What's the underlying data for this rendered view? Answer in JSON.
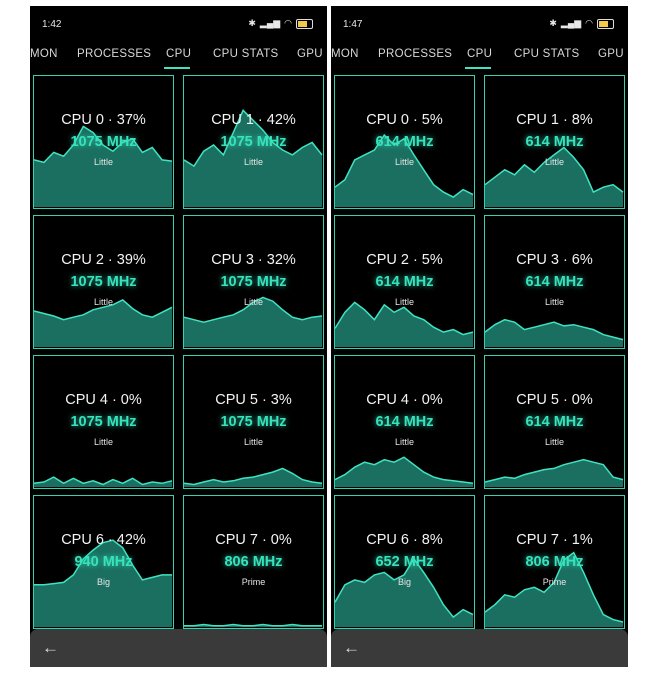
{
  "colors": {
    "accent": "#36e3bd",
    "graph_fill": "#1b6f60",
    "graph_line": "#3fe3c2",
    "border": "#37d1b1"
  },
  "screens": [
    {
      "time": "1:42",
      "tabs": [
        "MON",
        "PROCESSES",
        "CPU",
        "CPU STATS",
        "GPU"
      ],
      "active_tab": "CPU",
      "back_icon": "←",
      "cores": [
        {
          "label": "CPU 0 · 37%",
          "freq": "1075 MHz",
          "type": "Little",
          "graph": [
            0.38,
            0.36,
            0.44,
            0.41,
            0.5,
            0.65,
            0.6,
            0.5,
            0.45,
            0.52,
            0.55,
            0.44,
            0.48,
            0.38,
            0.37
          ]
        },
        {
          "label": "CPU 1 · 42%",
          "freq": "1075 MHz",
          "type": "Little",
          "graph": [
            0.38,
            0.33,
            0.45,
            0.5,
            0.42,
            0.6,
            0.78,
            0.7,
            0.62,
            0.52,
            0.46,
            0.42,
            0.48,
            0.52,
            0.42
          ]
        },
        {
          "label": "CPU 2 · 39%",
          "freq": "1075 MHz",
          "type": "Little",
          "graph": [
            0.29,
            0.27,
            0.25,
            0.22,
            0.24,
            0.26,
            0.3,
            0.32,
            0.34,
            0.38,
            0.31,
            0.26,
            0.24,
            0.28,
            0.32
          ]
        },
        {
          "label": "CPU 3 · 32%",
          "freq": "1075 MHz",
          "type": "Little",
          "graph": [
            0.24,
            0.22,
            0.2,
            0.22,
            0.24,
            0.26,
            0.3,
            0.36,
            0.4,
            0.37,
            0.3,
            0.24,
            0.22,
            0.24,
            0.25
          ]
        },
        {
          "label": "CPU 4 · 0%",
          "freq": "1075 MHz",
          "type": "Little",
          "graph": [
            0.03,
            0.04,
            0.08,
            0.03,
            0.07,
            0.03,
            0.05,
            0.02,
            0.06,
            0.03,
            0.07,
            0.02,
            0.04,
            0.03,
            0.05
          ]
        },
        {
          "label": "CPU 5 · 3%",
          "freq": "1075 MHz",
          "type": "Little",
          "graph": [
            0.03,
            0.02,
            0.04,
            0.06,
            0.04,
            0.05,
            0.07,
            0.08,
            0.1,
            0.12,
            0.15,
            0.11,
            0.06,
            0.04,
            0.03
          ]
        },
        {
          "label": "CPU 6 · 42%",
          "freq": "940 MHz",
          "type": "Big",
          "graph": [
            0.34,
            0.34,
            0.35,
            0.36,
            0.42,
            0.55,
            0.62,
            0.68,
            0.7,
            0.64,
            0.5,
            0.38,
            0.4,
            0.42,
            0.42
          ]
        },
        {
          "label": "CPU 7 · 0%",
          "freq": "806 MHz",
          "type": "Prime",
          "graph": [
            0.01,
            0.01,
            0.02,
            0.01,
            0.01,
            0.02,
            0.01,
            0.01,
            0.02,
            0.01,
            0.01,
            0.02,
            0.01,
            0.01,
            0.01
          ]
        }
      ]
    },
    {
      "time": "1:47",
      "tabs": [
        "MON",
        "PROCESSES",
        "CPU",
        "CPU STATS",
        "GPU"
      ],
      "active_tab": "CPU",
      "back_icon": "←",
      "cores": [
        {
          "label": "CPU 0 · 5%",
          "freq": "614 MHz",
          "type": "Little",
          "graph": [
            0.16,
            0.22,
            0.38,
            0.42,
            0.46,
            0.58,
            0.5,
            0.55,
            0.42,
            0.3,
            0.18,
            0.12,
            0.08,
            0.14,
            0.1
          ]
        },
        {
          "label": "CPU 1 · 8%",
          "freq": "614 MHz",
          "type": "Little",
          "graph": [
            0.18,
            0.24,
            0.3,
            0.26,
            0.34,
            0.28,
            0.36,
            0.42,
            0.48,
            0.4,
            0.3,
            0.12,
            0.16,
            0.18,
            0.12
          ]
        },
        {
          "label": "CPU 2 · 5%",
          "freq": "614 MHz",
          "type": "Little",
          "graph": [
            0.15,
            0.28,
            0.36,
            0.3,
            0.22,
            0.34,
            0.28,
            0.32,
            0.25,
            0.22,
            0.16,
            0.12,
            0.14,
            0.1,
            0.12
          ]
        },
        {
          "label": "CPU 3 · 6%",
          "freq": "614 MHz",
          "type": "Little",
          "graph": [
            0.12,
            0.18,
            0.22,
            0.2,
            0.14,
            0.16,
            0.18,
            0.2,
            0.17,
            0.18,
            0.16,
            0.14,
            0.1,
            0.08,
            0.06
          ]
        },
        {
          "label": "CPU 4 · 0%",
          "freq": "614 MHz",
          "type": "Little",
          "graph": [
            0.06,
            0.1,
            0.16,
            0.2,
            0.18,
            0.22,
            0.2,
            0.24,
            0.18,
            0.12,
            0.08,
            0.06,
            0.05,
            0.04,
            0.03
          ]
        },
        {
          "label": "CPU 5 · 0%",
          "freq": "614 MHz",
          "type": "Little",
          "graph": [
            0.04,
            0.06,
            0.08,
            0.07,
            0.1,
            0.12,
            0.14,
            0.15,
            0.18,
            0.2,
            0.22,
            0.2,
            0.18,
            0.08,
            0.06
          ]
        },
        {
          "label": "CPU 6 · 8%",
          "freq": "652 MHz",
          "type": "Big",
          "graph": [
            0.2,
            0.34,
            0.38,
            0.36,
            0.42,
            0.44,
            0.38,
            0.42,
            0.55,
            0.44,
            0.32,
            0.18,
            0.08,
            0.14,
            0.1
          ]
        },
        {
          "label": "CPU 7 · 1%",
          "freq": "806 MHz",
          "type": "Prime",
          "graph": [
            0.12,
            0.18,
            0.26,
            0.24,
            0.3,
            0.32,
            0.28,
            0.36,
            0.54,
            0.6,
            0.44,
            0.26,
            0.1,
            0.06,
            0.04
          ]
        }
      ]
    }
  ]
}
